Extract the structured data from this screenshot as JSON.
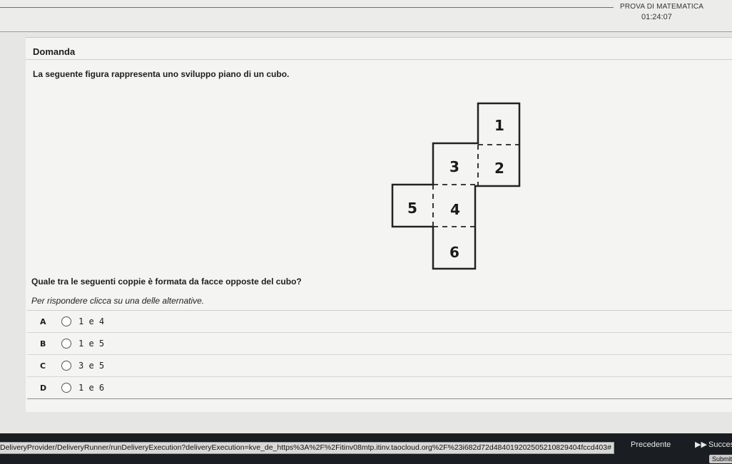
{
  "header": {
    "exam_title": "PROVA DI MATEMATICA",
    "timer": "01:24:07"
  },
  "question": {
    "section_label": "Domanda",
    "prompt": "La seguente figura rappresenta uno sviluppo piano di un cubo.",
    "text": "Quale tra le seguenti coppie è formata da facce opposte del cubo?",
    "instruction": "Per rispondere clicca su una delle alternative."
  },
  "figure": {
    "faces": [
      "1",
      "2",
      "3",
      "4",
      "5",
      "6"
    ]
  },
  "options": [
    {
      "letter": "A",
      "text": "1 e 4"
    },
    {
      "letter": "B",
      "text": "1 e 5"
    },
    {
      "letter": "C",
      "text": "3 e 5"
    },
    {
      "letter": "D",
      "text": "1 e 6"
    }
  ],
  "footer": {
    "status_url": "DeliveryProvider/DeliveryRunner/runDeliveryExecution?deliveryExecution=kve_de_https%3A%2F%2Fitinv08mtp.itinv.taocloud.org%2F%23i682d72d48401920250521082940​4fccd403#",
    "prev_label": "Precedente",
    "next_icon": "fast-forward-icon",
    "next_label": "Succes",
    "submit_label": "Submit an"
  }
}
